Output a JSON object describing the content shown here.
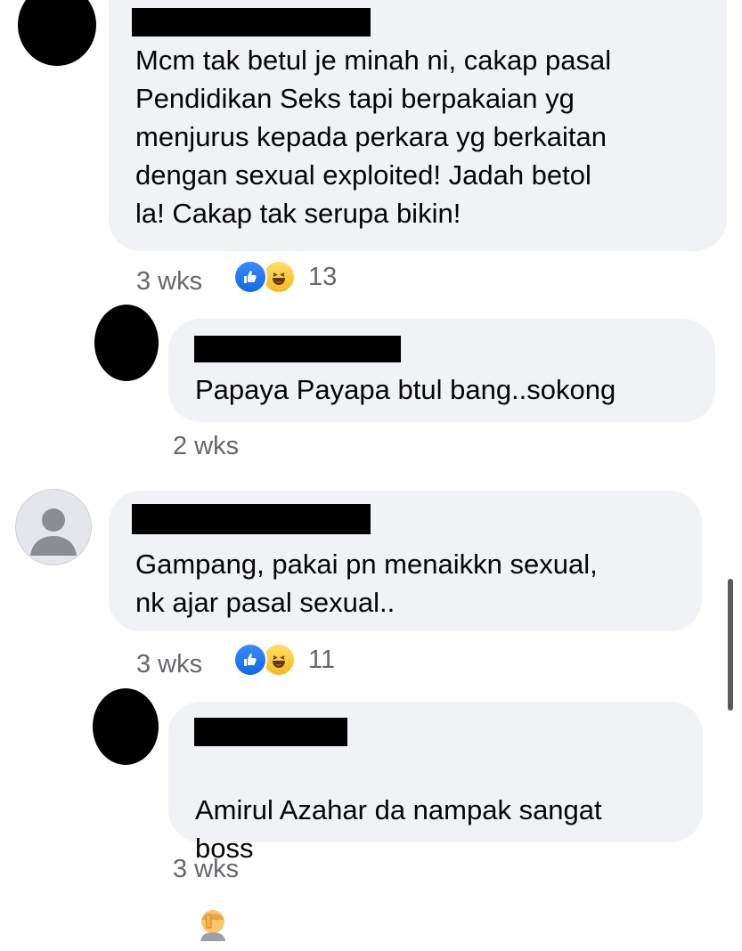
{
  "comments": [
    {
      "text": "Mcm tak betul je minah ni, cakap pasal\nPendidikan Seks tapi berpakaian yg\nmenjurus kepada perkara yg berkaitan\ndengan sexual exploited! Jadah betol\nla! Cakap tak serupa bikin!",
      "time": "3 wks",
      "reaction_count": "13",
      "reactions": [
        "like-icon",
        "haha-icon"
      ]
    },
    {
      "text": "Papaya Payapa btul bang..sokong",
      "time": "2 wks"
    },
    {
      "text": "Gampang, pakai pn menaikkn sexual,\nnk ajar pasal sexual..",
      "time": "3 wks",
      "reaction_count": "11",
      "reactions": [
        "like-icon",
        "haha-icon"
      ]
    },
    {
      "text": "Amirul Azahar da nampak sangat\nboss",
      "emoji": "facepalm-icon",
      "time": "3 wks"
    }
  ],
  "colors": {
    "bubble": "#f0f2f5",
    "meta_text": "#65676b",
    "like": "#1877f2",
    "haha": "#f7c22c"
  }
}
